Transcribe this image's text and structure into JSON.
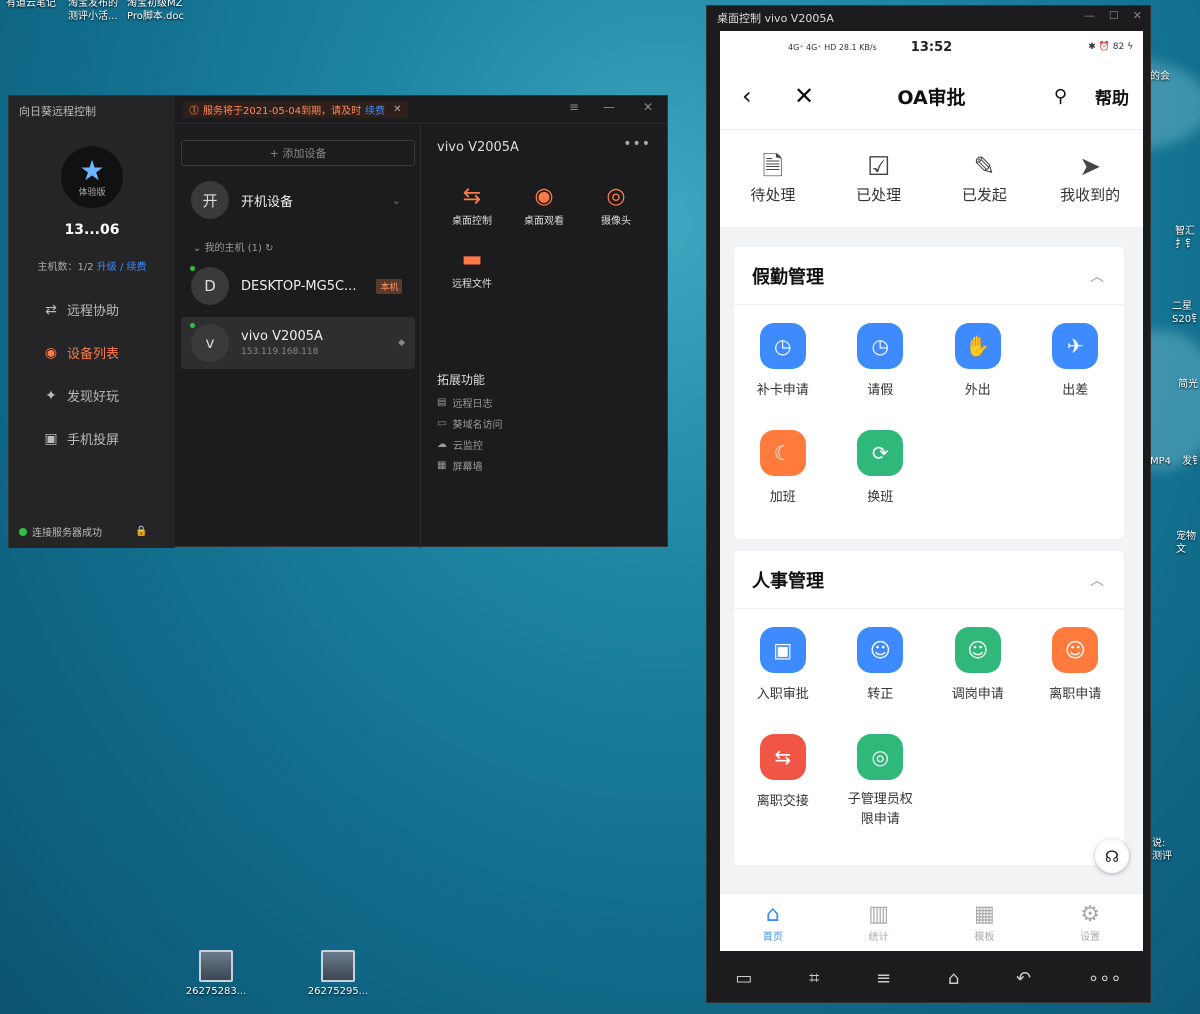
{
  "desktop": {
    "top_labels": [
      "有道云笔记",
      "淘宝发布的\n测评小活...",
      "淘宝初级MZ\nPro脚本.doc"
    ],
    "files": [
      {
        "name": "26275283..."
      },
      {
        "name": "26275295..."
      }
    ],
    "right_labels": [
      "的会",
      "智汇\n扌钅",
      "二星\nS20钅",
      "简光",
      "MP4",
      "发钅",
      "宠物\n文",
      "说:\n测评"
    ]
  },
  "sunlogin": {
    "app_name": "向日葵远程控制",
    "notice_text": "服务将于2021-05-04到期，请及时",
    "notice_link": "续费",
    "avatar_tier": "体验版",
    "user_id": "13...06",
    "hosts_label": "主机数：1/2",
    "upgrade_link": "升级 / 续费",
    "nav": [
      {
        "label": "远程协助",
        "icon": "remote-assist-icon",
        "glyph": "⇄"
      },
      {
        "label": "设备列表",
        "icon": "device-list-icon",
        "glyph": "◉",
        "active": true
      },
      {
        "label": "发现好玩",
        "icon": "discover-icon",
        "glyph": "✦"
      },
      {
        "label": "手机投屏",
        "icon": "screen-cast-icon",
        "glyph": "▣"
      }
    ],
    "connection_status": "连接服务器成功",
    "add_device": "+ 添加设备",
    "power_on_device": "开机设备",
    "power_on_glyph": "开",
    "my_hosts_group": "我的主机 (1)",
    "devices": [
      {
        "initial": "D",
        "name": "DESKTOP-MG5C...",
        "tag": "本机",
        "ip": ""
      },
      {
        "initial": "v",
        "name": "vivo V2005A",
        "tag": "",
        "ip": "153.119.168.118"
      }
    ],
    "selected_device": "vivo V2005A",
    "actions": [
      {
        "label": "桌面控制",
        "glyph": "⇆",
        "icon": "desktop-control-icon"
      },
      {
        "label": "桌面观看",
        "glyph": "◉",
        "icon": "desktop-view-icon"
      },
      {
        "label": "摄像头",
        "glyph": "◎",
        "icon": "camera-icon"
      },
      {
        "label": "远程文件",
        "glyph": "▬",
        "icon": "folder-icon"
      }
    ],
    "extensions_title": "拓展功能",
    "extensions": [
      {
        "label": "远程日志",
        "glyph": "▤"
      },
      {
        "label": "葵域名访问",
        "glyph": "▭"
      },
      {
        "label": "云监控",
        "glyph": "☁"
      },
      {
        "label": "屏幕墙",
        "glyph": "▦"
      }
    ]
  },
  "phone": {
    "window_title": "桌面控制 vivo V2005A",
    "status_time": "13:52",
    "status_left": "4G⁺ 4G⁺ HD 28.1 KB/s",
    "status_right": "✱ ⏰ 82 ϟ",
    "header_title": "OA审批",
    "help": "帮助",
    "quick_actions": [
      {
        "label": "待处理",
        "glyph": "🗎"
      },
      {
        "label": "已处理",
        "glyph": "☑"
      },
      {
        "label": "已发起",
        "glyph": "✎"
      },
      {
        "label": "我收到的",
        "glyph": "➤"
      }
    ],
    "sections": [
      {
        "title": "假勤管理",
        "items": [
          {
            "label": "补卡申请",
            "color": "blue",
            "glyph": "◷"
          },
          {
            "label": "请假",
            "color": "blue",
            "glyph": "◷"
          },
          {
            "label": "外出",
            "color": "blue",
            "glyph": "✋"
          },
          {
            "label": "出差",
            "color": "blue",
            "glyph": "✈"
          },
          {
            "label": "加班",
            "color": "orange",
            "glyph": "☾"
          },
          {
            "label": "换班",
            "color": "green",
            "glyph": "⟳"
          }
        ]
      },
      {
        "title": "人事管理",
        "items": [
          {
            "label": "入职审批",
            "color": "blue",
            "glyph": "▣"
          },
          {
            "label": "转正",
            "color": "blue",
            "glyph": "☺"
          },
          {
            "label": "调岗申请",
            "color": "green",
            "glyph": "☺"
          },
          {
            "label": "离职申请",
            "color": "orange",
            "glyph": "☺"
          },
          {
            "label": "离职交接",
            "color": "red",
            "glyph": "⇆"
          },
          {
            "label": "子管理员权\n限申请",
            "color": "green",
            "glyph": "◎"
          }
        ]
      }
    ],
    "tabs": [
      {
        "label": "首页",
        "glyph": "⌂",
        "active": true
      },
      {
        "label": "统计",
        "glyph": "▥"
      },
      {
        "label": "模板",
        "glyph": "▦"
      },
      {
        "label": "设置",
        "glyph": "⚙"
      }
    ],
    "nav_buttons": [
      "▭",
      "⌗",
      "≡",
      "⌂",
      "↶",
      "∘∘∘"
    ]
  }
}
